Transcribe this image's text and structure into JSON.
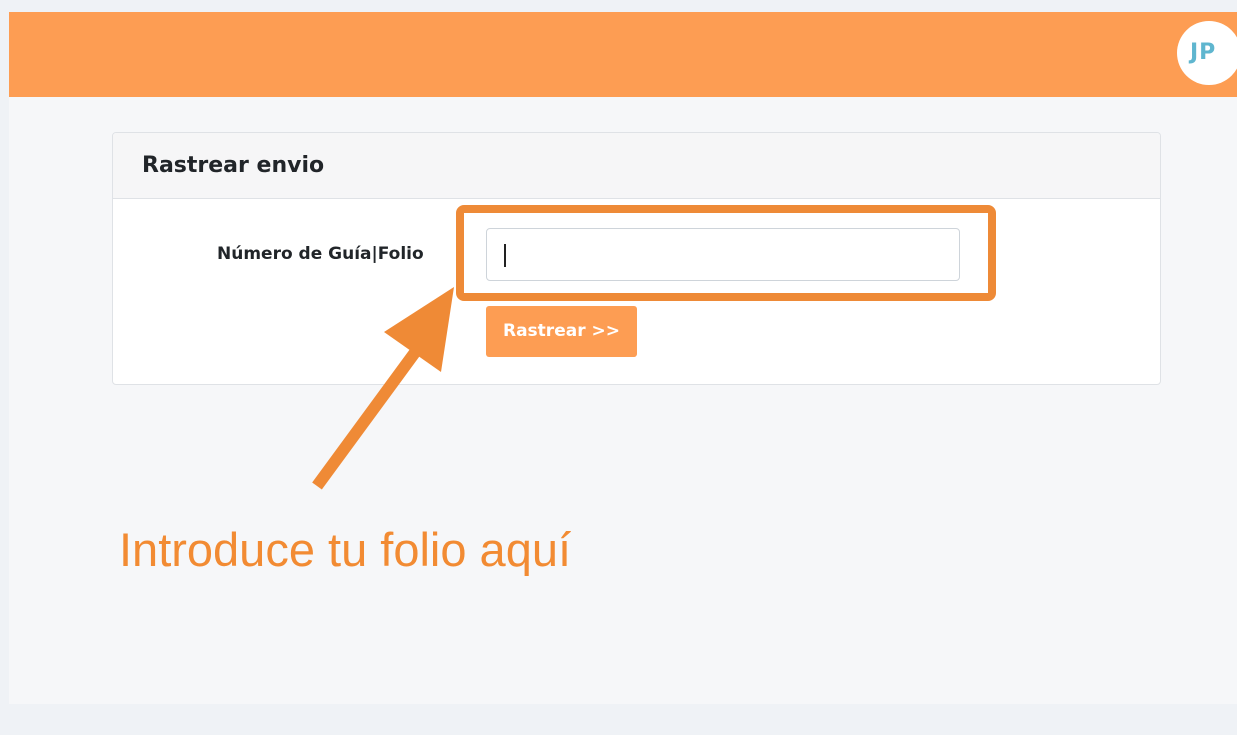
{
  "header": {
    "avatar_initials": "JP",
    "background_color": "#fd9d53"
  },
  "card": {
    "title": "Rastrear envio",
    "field_label": "Número de Guía|Folio",
    "input_value": "",
    "button_label": "Rastrear >>"
  },
  "annotation": {
    "caption": "Introduce tu folio aquí",
    "color": "#f28b33"
  }
}
